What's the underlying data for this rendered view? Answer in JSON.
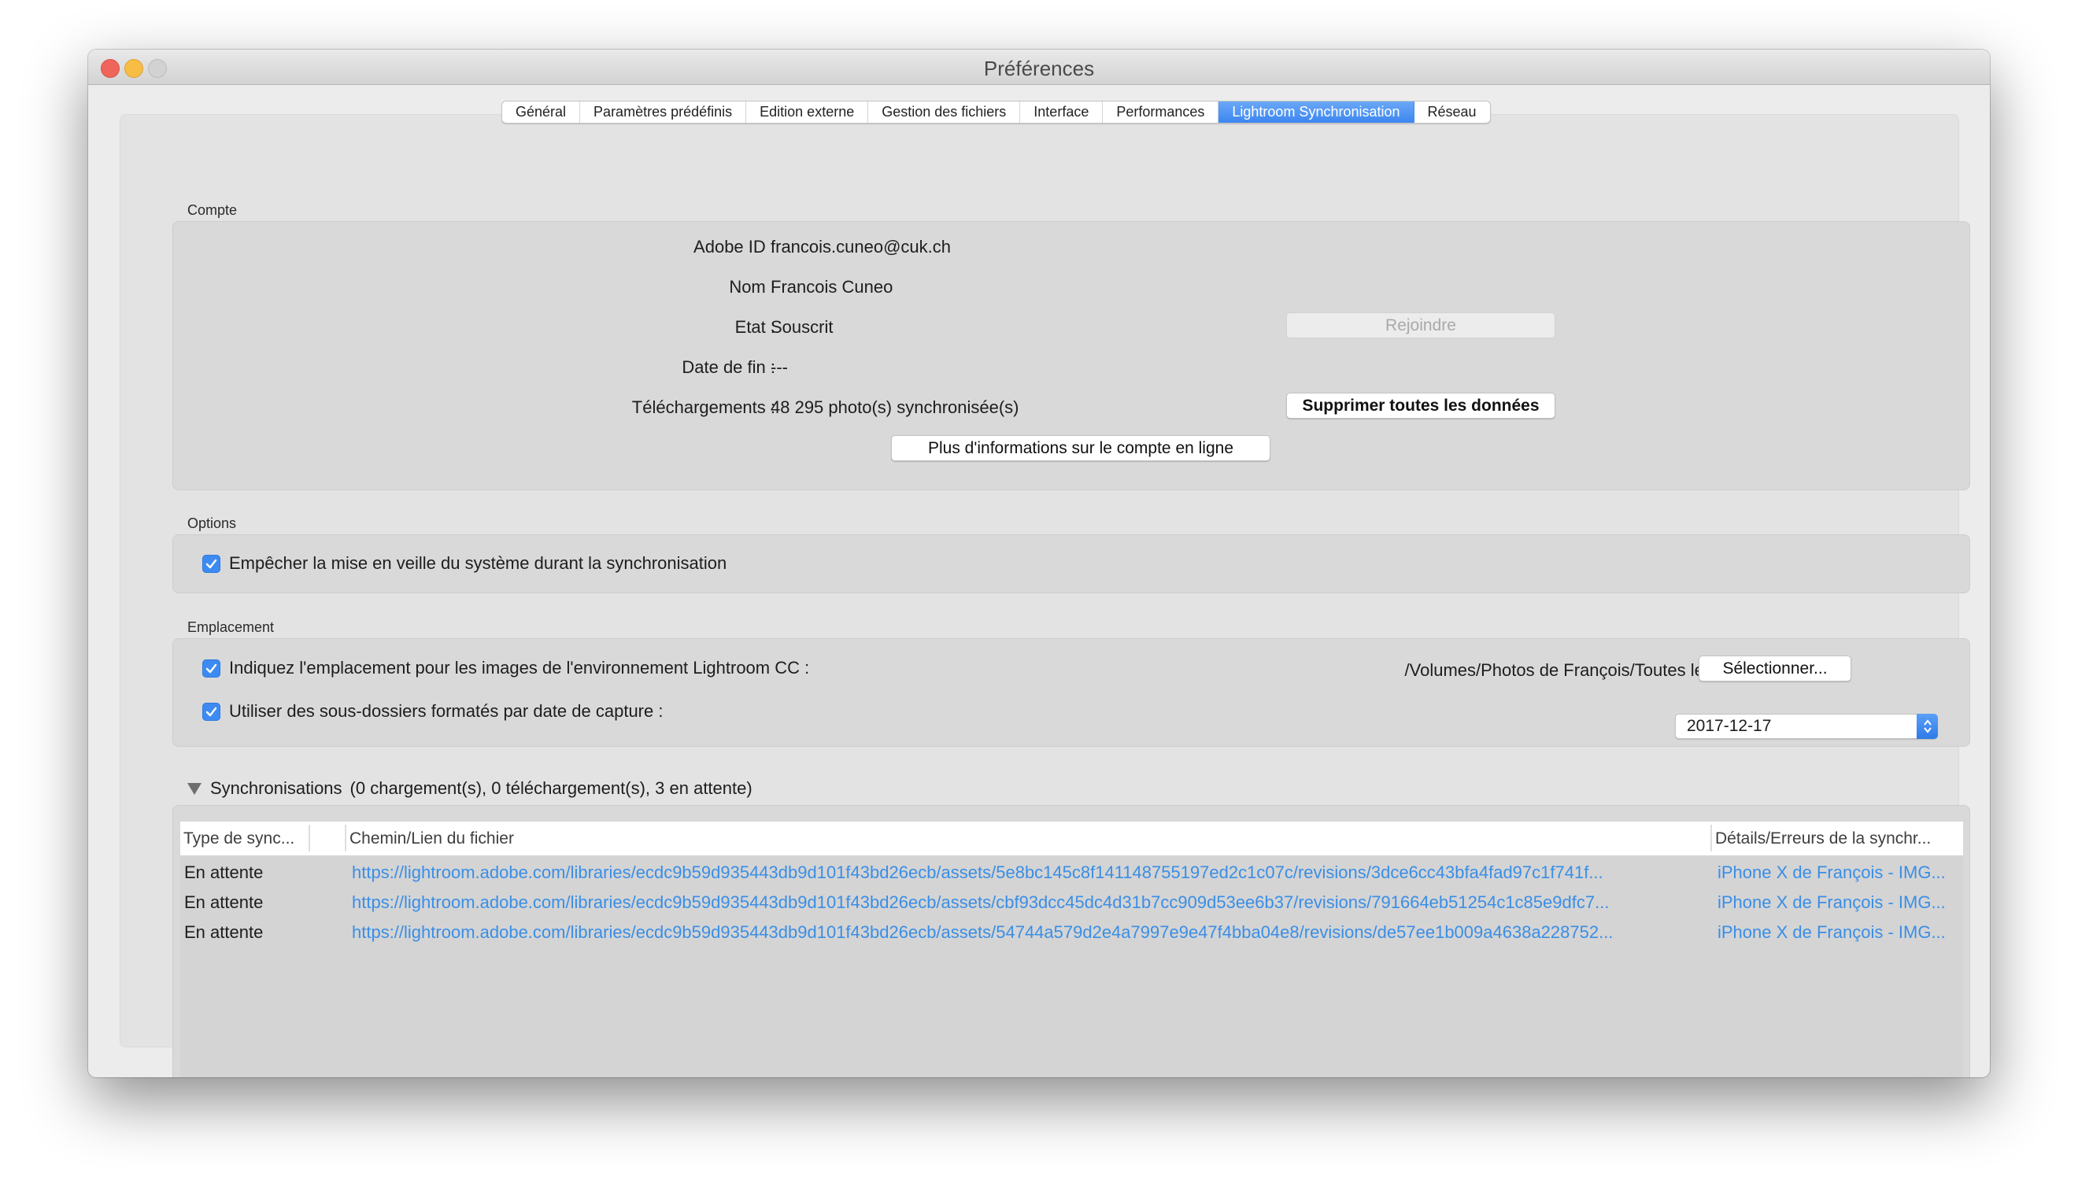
{
  "window": {
    "title": "Préférences",
    "traffic_lights": [
      "close",
      "minimize",
      "zoom"
    ]
  },
  "tabs": [
    {
      "label": "Général",
      "active": false
    },
    {
      "label": "Paramètres prédéfinis",
      "active": false
    },
    {
      "label": "Edition externe",
      "active": false
    },
    {
      "label": "Gestion des fichiers",
      "active": false
    },
    {
      "label": "Interface",
      "active": false
    },
    {
      "label": "Performances",
      "active": false
    },
    {
      "label": "Lightroom Synchronisation",
      "active": true
    },
    {
      "label": "Réseau",
      "active": false
    }
  ],
  "account": {
    "section_label": "Compte",
    "fields": [
      {
        "label": "Adobe ID :",
        "value": "francois.cuneo@cuk.ch"
      },
      {
        "label": "Nom :",
        "value": "Francois Cuneo"
      },
      {
        "label": "Etat :",
        "value": "Souscrit"
      },
      {
        "label": "Date de fin :",
        "value": "---"
      },
      {
        "label": "Téléchargements :",
        "value": "48 295 photo(s) synchronisée(s)"
      }
    ],
    "join_button": "Rejoindre",
    "delete_button": "Supprimer toutes les données",
    "more_info_button": "Plus d'informations sur le compte en ligne"
  },
  "options": {
    "section_label": "Options",
    "prevent_sleep": {
      "label": "Empêcher la mise en veille du système durant la synchronisation",
      "checked": true
    }
  },
  "location": {
    "section_label": "Emplacement",
    "specify_location": {
      "label": "Indiquez l'emplacement pour les images de l'environnement Lightroom CC :",
      "checked": true
    },
    "path": "/Volumes/Photos de François/Toutes les photos",
    "select_button": "Sélectionner...",
    "use_subfolders": {
      "label": "Utiliser des sous-dossiers formatés par date de capture :",
      "checked": true
    },
    "date_format": "2017-12-17"
  },
  "sync": {
    "title": "Synchronisations",
    "summary": "(0 chargement(s), 0 téléchargement(s), 3 en attente)",
    "expanded": true,
    "columns": [
      "Type de sync...",
      "Chemin/Lien du fichier",
      "Détails/Erreurs de la synchr..."
    ],
    "rows": [
      {
        "type": "En attente",
        "path": "https://lightroom.adobe.com/libraries/ecdc9b59d935443db9d101f43bd26ecb/assets/5e8bc145c8f141148755197ed2c1c07c/revisions/3dce6cc43bfa4fad97c1f741f...",
        "details": "iPhone X de François  - IMG..."
      },
      {
        "type": "En attente",
        "path": "https://lightroom.adobe.com/libraries/ecdc9b59d935443db9d101f43bd26ecb/assets/cbf93dcc45dc4d31b7cc909d53ee6b37/revisions/791664eb51254c1c85e9dfc7...",
        "details": "iPhone X de François  - IMG..."
      },
      {
        "type": "En attente",
        "path": "https://lightroom.adobe.com/libraries/ecdc9b59d935443db9d101f43bd26ecb/assets/54744a579d2e4a7997e9e47f4bba04e8/revisions/de57ee1b009a4638a228752...",
        "details": "iPhone X de François  - IMG..."
      }
    ]
  },
  "colors": {
    "accent": "#3d86f0",
    "link": "#3a8ee6",
    "close": "#f0655b",
    "minimize": "#f8bd45"
  }
}
